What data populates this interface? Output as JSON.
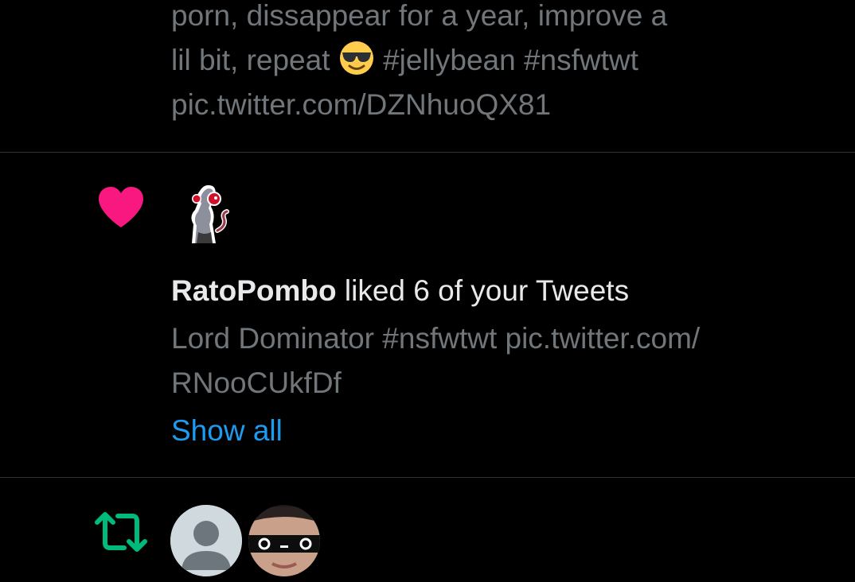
{
  "notifications": {
    "previous": {
      "tweet_text_line1": "porn, dissappear for a year, improve a",
      "tweet_text_line2_before": "lil bit, repeat",
      "tweet_text_line2_emoji": "smiling-face-with-sunglasses",
      "tweet_text_line2_after": "#jellybean #nsfwtwt",
      "tweet_text_line3": "pic.twitter.com/DZNhuoQX81"
    },
    "like": {
      "icon": "heart-icon",
      "icon_color": "#f91880",
      "user": "RatoPombo",
      "action": "liked 6 of your Tweets",
      "tweet_text_line1": "Lord Dominator #nsfwtwt pic.twitter.com/",
      "tweet_text_line2": "RNooCUkfDf",
      "show_all": "Show all",
      "link_color": "#1d9bf0"
    },
    "retweet": {
      "icon": "retweet-icon",
      "icon_color": "#00ba7c"
    }
  }
}
